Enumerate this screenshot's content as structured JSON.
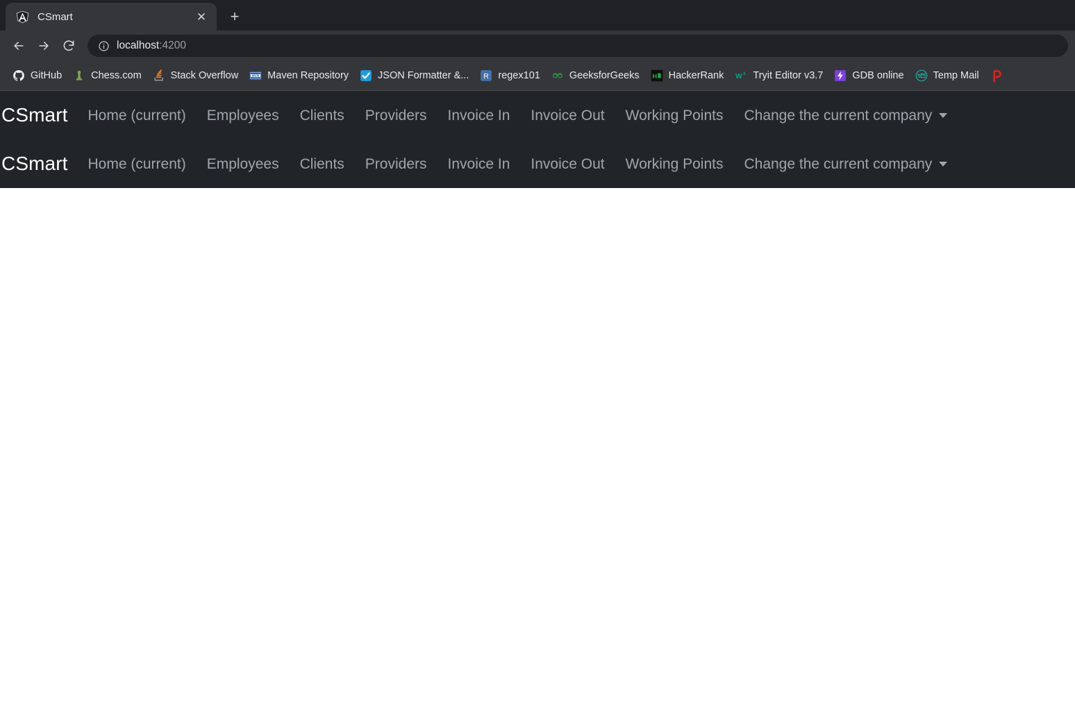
{
  "browser": {
    "tab": {
      "title": "CSmart",
      "favicon": "angular-shield-icon",
      "close_label": "✕"
    },
    "newtab_label": "+",
    "toolbar": {
      "back_label": "Back",
      "forward_label": "Forward",
      "reload_label": "Reload",
      "url_host": "localhost",
      "url_rest": ":4200",
      "site_info_label": "Site information"
    },
    "bookmarks": [
      {
        "label": "GitHub",
        "icon": "github-icon"
      },
      {
        "label": "Chess.com",
        "icon": "chess-pawn-icon"
      },
      {
        "label": "Stack Overflow",
        "icon": "stack-overflow-icon"
      },
      {
        "label": "Maven Repository",
        "icon": "maven-icon"
      },
      {
        "label": "JSON Formatter &...",
        "icon": "checkbox-blue-icon"
      },
      {
        "label": "regex101",
        "icon": "regex101-icon"
      },
      {
        "label": "GeeksforGeeks",
        "icon": "geeksforgeeks-icon"
      },
      {
        "label": "HackerRank",
        "icon": "hackerrank-icon"
      },
      {
        "label": "Tryit Editor v3.7",
        "icon": "w3schools-icon"
      },
      {
        "label": "GDB online",
        "icon": "gdb-lightning-icon"
      },
      {
        "label": "Temp Mail",
        "icon": "temp-mail-icon"
      },
      {
        "label": "",
        "icon": "pocket-p-icon"
      }
    ]
  },
  "app": {
    "brand": "CSmart",
    "nav_items": [
      "Home (current)",
      "Employees",
      "Clients",
      "Providers",
      "Invoice In",
      "Invoice Out",
      "Working Points"
    ],
    "company_dropdown": "Change the current company",
    "navbar_count": 2,
    "colors": {
      "navbar_bg": "#212529",
      "navbar_link": "#9fa6ad",
      "brand_text": "#ffffff",
      "page_bg": "#ffffff"
    }
  }
}
